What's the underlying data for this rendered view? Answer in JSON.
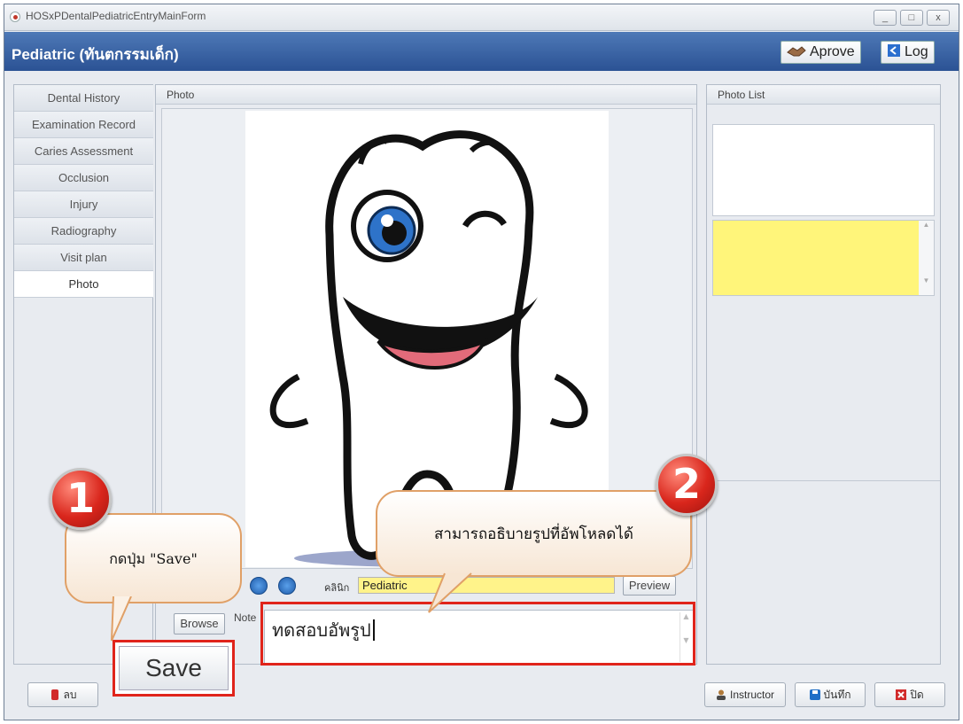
{
  "window": {
    "title": "HOSxPDentalPediatricEntryMainForm",
    "min": "_",
    "max": "□",
    "close": "x"
  },
  "header": {
    "title": "Pediatric (ทันตกรรมเด็ก)",
    "approve_label": "Aprove",
    "log_label": "Log"
  },
  "tabs": [
    {
      "label": "Dental History"
    },
    {
      "label": "Examination Record"
    },
    {
      "label": "Caries Assessment"
    },
    {
      "label": "Occlusion"
    },
    {
      "label": "Injury"
    },
    {
      "label": "Radiography"
    },
    {
      "label": "Visit plan"
    },
    {
      "label": "Photo"
    }
  ],
  "photo_panel": {
    "title": "Photo",
    "clinic_label": "คลินิก",
    "clinic_value": "Pediatric",
    "preview_label": "Preview",
    "browse_label": "Browse",
    "note_label": "Note",
    "note_value": "ทดสอบอัพรูป"
  },
  "photo_list": {
    "title": "Photo List"
  },
  "footer": {
    "delete_label": "ลบ",
    "instructor_label": "Instructor",
    "save_label": "บันทึก",
    "close_label": "ปิด"
  },
  "annotations": {
    "badge1": "1",
    "badge2": "2",
    "callout1": "กดปุ่ม \"Save\"",
    "callout2": "สามารถอธิบายรูปที่อัพโหลดได้",
    "save_big": "Save"
  },
  "colors": {
    "header_blue": "#2b5294",
    "clinic_yellow": "#fff38a",
    "highlight_red": "#e0241b"
  }
}
